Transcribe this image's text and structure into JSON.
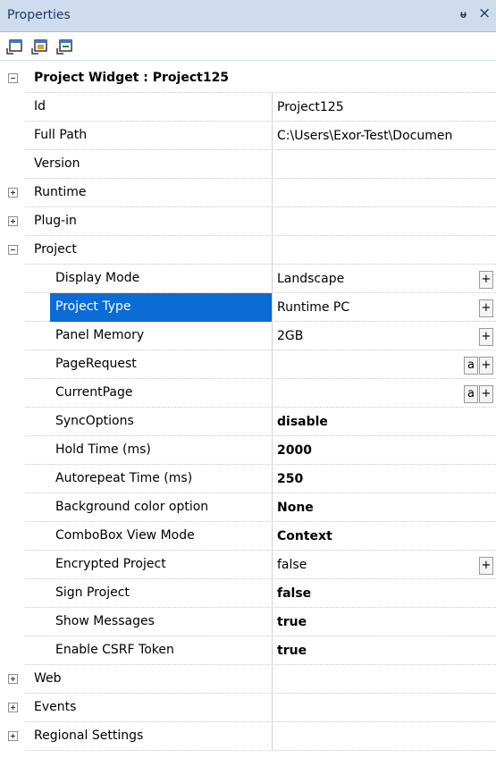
{
  "panel": {
    "title": "Properties",
    "pin_icon": "pin-icon",
    "close_label": "×"
  },
  "toolbar": {
    "icons": [
      "categorized-view-icon",
      "alphabetical-view-icon",
      "property-pages-icon"
    ]
  },
  "group": {
    "header": "Project Widget : Project125"
  },
  "rows": {
    "id": {
      "name": "Id",
      "value": "Project125"
    },
    "full_path": {
      "name": "Full Path",
      "value": "C:\\Users\\Exor-Test\\Documen"
    },
    "version": {
      "name": "Version",
      "value": ""
    },
    "runtime": {
      "name": "Runtime"
    },
    "plugin": {
      "name": "Plug-in"
    },
    "project": {
      "name": "Project"
    },
    "display_mode": {
      "name": "Display Mode",
      "value": "Landscape"
    },
    "project_type": {
      "name": "Project Type",
      "value": "Runtime PC"
    },
    "panel_memory": {
      "name": "Panel Memory",
      "value": "2GB"
    },
    "page_request": {
      "name": "PageRequest",
      "value": ""
    },
    "current_page": {
      "name": "CurrentPage",
      "value": ""
    },
    "sync_options": {
      "name": "SyncOptions",
      "value": "disable"
    },
    "hold_time": {
      "name": "Hold Time (ms)",
      "value": "2000"
    },
    "autorepeat_time": {
      "name": "Autorepeat Time (ms)",
      "value": "250"
    },
    "background_color": {
      "name": "Background color option",
      "value": "None"
    },
    "combobox_view_mode": {
      "name": "ComboBox View Mode",
      "value": "Context"
    },
    "encrypted_project": {
      "name": "Encrypted Project",
      "value": "false"
    },
    "sign_project": {
      "name": "Sign Project",
      "value": "false"
    },
    "show_messages": {
      "name": "Show Messages",
      "value": "true"
    },
    "enable_csrf": {
      "name": "Enable CSRF Token",
      "value": "true"
    },
    "web": {
      "name": "Web"
    },
    "events": {
      "name": "Events"
    },
    "regional_settings": {
      "name": "Regional Settings"
    }
  },
  "buttons": {
    "plus_label": "+",
    "attach_label": "a"
  },
  "colors": {
    "titlebar_bg": "#cfdcf0",
    "selection": "#0a6cd4"
  }
}
